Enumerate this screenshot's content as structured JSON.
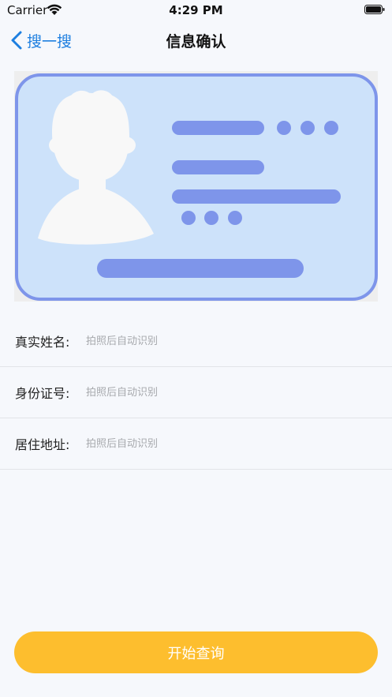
{
  "status_bar": {
    "carrier": "Carrier",
    "time": "4:29 PM",
    "icons": [
      "wifi-icon",
      "battery-icon"
    ]
  },
  "nav": {
    "back_label": "搜一搜",
    "title": "信息确认",
    "back_icon": "chevron-left-icon"
  },
  "card_illustration": {
    "icon": "id-card-icon",
    "colors": {
      "card_fill": "#cde2fa",
      "card_border": "#7e95ea",
      "bars": "#7e95ea",
      "avatar": "#f8f8f8",
      "background": "#eeeeee"
    }
  },
  "form": {
    "rows": [
      {
        "label": "真实姓名:",
        "placeholder": "拍照后自动识别"
      },
      {
        "label": "身份证号:",
        "placeholder": "拍照后自动识别"
      },
      {
        "label": "居住地址:",
        "placeholder": "拍照后自动识别"
      }
    ]
  },
  "actions": {
    "start_label": "开始查询"
  },
  "colors": {
    "accent_blue": "#1e7fe0",
    "button_yellow": "#fdbe2e",
    "page_background": "#f6f8fc",
    "placeholder_gray": "#a7a9ad"
  }
}
